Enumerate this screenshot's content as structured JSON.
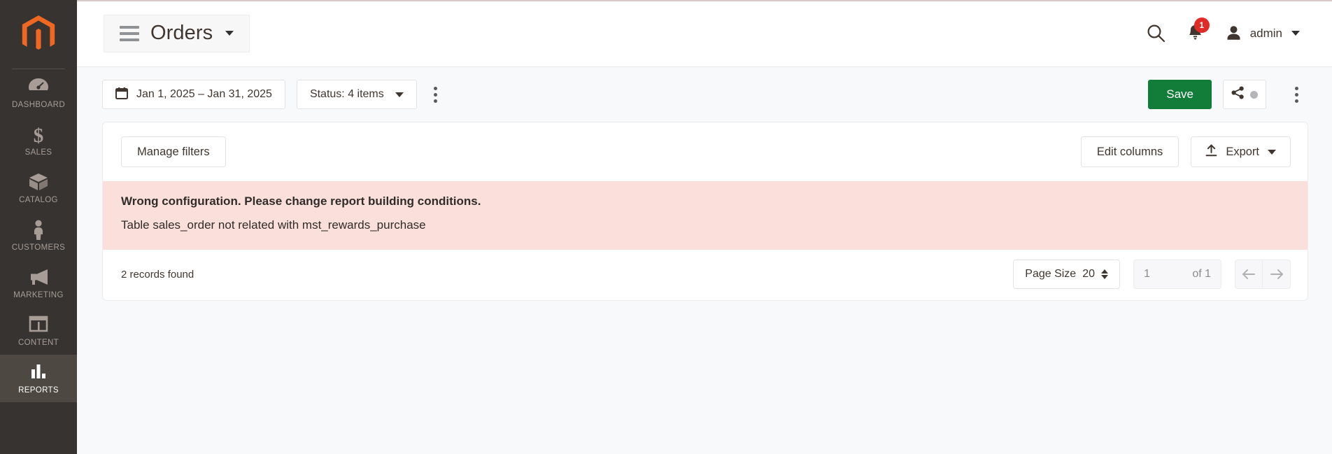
{
  "sidebar": {
    "logo_name": "magento-logo",
    "items": [
      {
        "label": "DASHBOARD",
        "icon": "dashboard-gauge-icon",
        "active": false
      },
      {
        "label": "SALES",
        "icon": "dollar-sign-icon",
        "active": false
      },
      {
        "label": "CATALOG",
        "icon": "box-icon",
        "active": false
      },
      {
        "label": "CUSTOMERS",
        "icon": "person-icon",
        "active": false
      },
      {
        "label": "MARKETING",
        "icon": "megaphone-icon",
        "active": false
      },
      {
        "label": "CONTENT",
        "icon": "layout-panel-icon",
        "active": false
      },
      {
        "label": "REPORTS",
        "icon": "bar-chart-icon",
        "active": true
      }
    ]
  },
  "header": {
    "menu_icon": "hamburger-menu-icon",
    "title": "Orders",
    "title_caret": "chevron-down-icon",
    "search_icon": "search-icon",
    "notifications_icon": "bell-icon",
    "notifications_count": "1",
    "account_icon": "user-avatar-icon",
    "account_name": "admin",
    "account_caret": "chevron-down-icon"
  },
  "toolbar": {
    "calendar_icon": "calendar-icon",
    "date_range": "Jan 1, 2025 – Jan 31, 2025",
    "status_filter": "Status: 4 items",
    "status_caret": "chevron-down-icon",
    "more_icon": "kebab-menu-icon",
    "save_label": "Save",
    "share_icon": "share-icon",
    "share_dot": "status-dot",
    "more_right_icon": "kebab-menu-icon"
  },
  "card": {
    "manage_filters_label": "Manage filters",
    "edit_columns_label": "Edit columns",
    "export_label": "Export",
    "export_icon": "upload-icon",
    "export_caret": "chevron-down-icon"
  },
  "error": {
    "title": "Wrong configuration. Please change report building conditions.",
    "detail": "Table sales_order not related with mst_rewards_purchase"
  },
  "footer": {
    "records_found": "2 records found",
    "page_size_label": "Page Size",
    "page_size_value": "20",
    "page_size_spinner": "stepper-icon",
    "current_page": "1",
    "of_pages": "of 1",
    "prev_icon": "arrow-left-icon",
    "next_icon": "arrow-right-icon"
  },
  "colors": {
    "sidebar_bg": "#373330",
    "sidebar_active": "#4e4843",
    "accent_orange": "#ee6723",
    "save_green": "#127c39",
    "error_bg": "#fbdfda",
    "badge_red": "#e02b27",
    "page_bg": "#f8f9fb"
  }
}
